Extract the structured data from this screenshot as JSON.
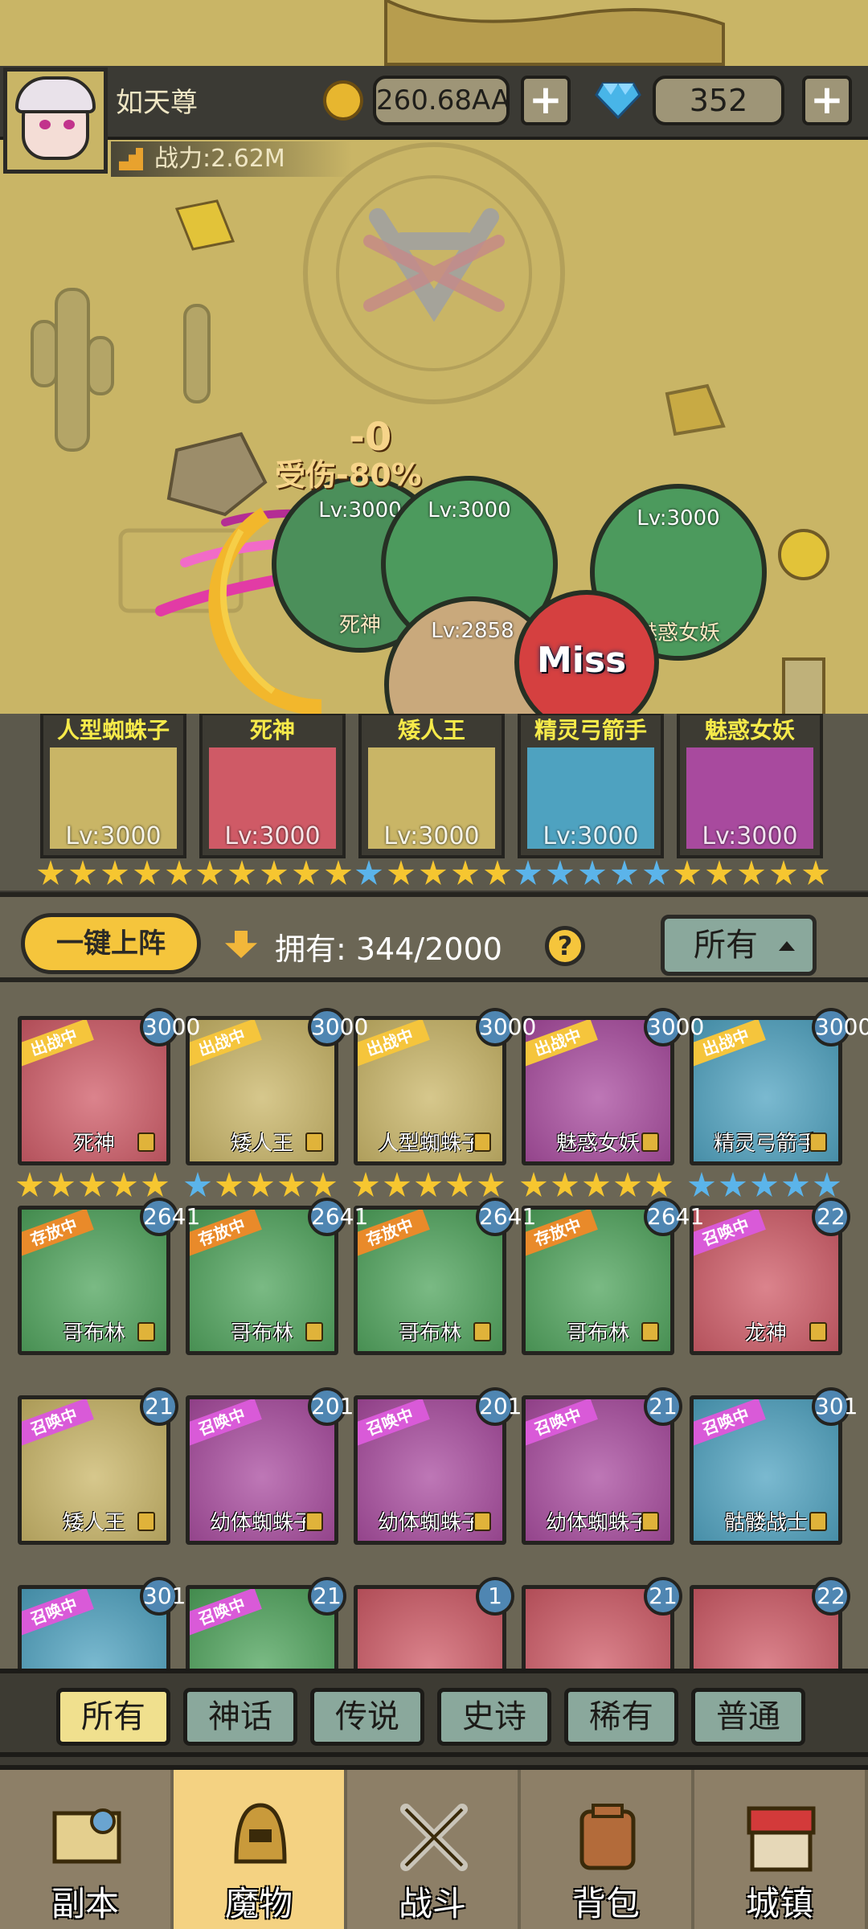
{
  "player": {
    "name": "如天尊",
    "power": "战力:2.62M"
  },
  "currency": {
    "gold": "260.68AA",
    "gems": "352",
    "plus": "+"
  },
  "battle": {
    "damage_text": "受伤-80%",
    "damage_zero": "-0",
    "miss_text": "Miss",
    "units": [
      {
        "level": "Lv:3000",
        "name": "死神"
      },
      {
        "level": "Lv:3000",
        "name": ""
      },
      {
        "level": "Lv:3000",
        "name": "魅惑女妖"
      },
      {
        "level": "Lv:2858",
        "name": ""
      }
    ]
  },
  "lineup": [
    {
      "title": "人型蜘蛛子",
      "level": "Lv:3000",
      "stars": "gold",
      "color": "#c9b566"
    },
    {
      "title": "死神",
      "level": "Lv:3000",
      "stars": "gold",
      "color": "#cf5a66"
    },
    {
      "title": "矮人王",
      "level": "Lv:3000",
      "stars": "mixed",
      "color": "#c9b566"
    },
    {
      "title": "精灵弓箭手",
      "level": "Lv:3000",
      "stars": "blue",
      "color": "#4ea2c0"
    },
    {
      "title": "魅惑女妖",
      "level": "Lv:3000",
      "stars": "gold",
      "color": "#a84a9e"
    }
  ],
  "controls": {
    "deploy": "一键上阵",
    "owned": "拥有: 344/2000",
    "help": "?",
    "filter": "所有"
  },
  "monsters": [
    {
      "name": "死神",
      "badge": "3000",
      "ribbon": "出战中",
      "color": "#cf5a66",
      "stars": "gold"
    },
    {
      "name": "矮人王",
      "badge": "3000",
      "ribbon": "出战中",
      "color": "#c9b566",
      "stars": "mixed"
    },
    {
      "name": "人型蜘蛛子",
      "badge": "3000",
      "ribbon": "出战中",
      "color": "#c9b566",
      "stars": "gold"
    },
    {
      "name": "魅惑女妖",
      "badge": "3000",
      "ribbon": "出战中",
      "color": "#a84a9e",
      "stars": "gold"
    },
    {
      "name": "精灵弓箭手",
      "badge": "3000",
      "ribbon": "出战中",
      "color": "#4ea2c0",
      "stars": "blue"
    },
    {
      "name": "哥布林",
      "badge": "2641",
      "ribbon": "存放中",
      "color": "#4ea35b",
      "stars": ""
    },
    {
      "name": "哥布林",
      "badge": "2641",
      "ribbon": "存放中",
      "color": "#4ea35b",
      "stars": ""
    },
    {
      "name": "哥布林",
      "badge": "2641",
      "ribbon": "存放中",
      "color": "#4ea35b",
      "stars": ""
    },
    {
      "name": "哥布林",
      "badge": "2641",
      "ribbon": "存放中",
      "color": "#4ea35b",
      "stars": ""
    },
    {
      "name": "龙神",
      "badge": "22",
      "ribbon": "召唤中",
      "color": "#cf5a66",
      "stars": ""
    },
    {
      "name": "矮人王",
      "badge": "21",
      "ribbon": "召唤中",
      "color": "#c9b566",
      "stars": ""
    },
    {
      "name": "幼体蜘蛛子",
      "badge": "201",
      "ribbon": "召唤中",
      "color": "#a84a9e",
      "stars": ""
    },
    {
      "name": "幼体蜘蛛子",
      "badge": "201",
      "ribbon": "召唤中",
      "color": "#a84a9e",
      "stars": ""
    },
    {
      "name": "幼体蜘蛛子",
      "badge": "21",
      "ribbon": "召唤中",
      "color": "#a84a9e",
      "stars": ""
    },
    {
      "name": "骷髅战士",
      "badge": "301",
      "ribbon": "召唤中",
      "color": "#4ea2c0",
      "stars": ""
    },
    {
      "name": "",
      "badge": "301",
      "ribbon": "召唤中",
      "color": "#4ea2c0",
      "stars": ""
    },
    {
      "name": "",
      "badge": "21",
      "ribbon": "召唤中",
      "color": "#4ea35b",
      "stars": ""
    },
    {
      "name": "",
      "badge": "1",
      "ribbon": "",
      "color": "#cf5a66",
      "stars": ""
    },
    {
      "name": "",
      "badge": "21",
      "ribbon": "",
      "color": "#cf5a66",
      "stars": ""
    },
    {
      "name": "",
      "badge": "22",
      "ribbon": "",
      "color": "#cf5a66",
      "stars": ""
    }
  ],
  "rarity_tabs": [
    "所有",
    "神话",
    "传说",
    "史诗",
    "稀有",
    "普通"
  ],
  "nav": [
    "副本",
    "魔物",
    "战斗",
    "背包",
    "城镇"
  ],
  "colors": {
    "ribbon_battle": "#f5c53c",
    "ribbon_stored": "#e98a2a",
    "ribbon_summon": "#d95ad8",
    "gold_star": "#f6c630",
    "blue_star": "#5bb4ea"
  }
}
